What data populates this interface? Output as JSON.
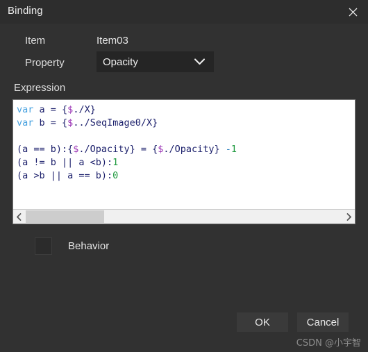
{
  "window": {
    "title": "Binding",
    "close_icon": "close-icon"
  },
  "form": {
    "item_label": "Item",
    "item_value": "Item03",
    "property_label": "Property",
    "property_selected": "Opacity",
    "property_chevron_icon": "chevron-down-icon",
    "expression_label": "Expression"
  },
  "expression": {
    "lines": [
      [
        {
          "t": "var",
          "c": "kw"
        },
        {
          "t": " a = {",
          "c": "def"
        },
        {
          "t": "$",
          "c": "var"
        },
        {
          "t": "./X}",
          "c": "def"
        }
      ],
      [
        {
          "t": "var",
          "c": "kw"
        },
        {
          "t": " b = {",
          "c": "def"
        },
        {
          "t": "$",
          "c": "var"
        },
        {
          "t": "../SeqImage0/X}",
          "c": "def"
        }
      ],
      [],
      [
        {
          "t": "(a == b):{",
          "c": "def"
        },
        {
          "t": "$",
          "c": "var"
        },
        {
          "t": "./Opacity} = {",
          "c": "def"
        },
        {
          "t": "$",
          "c": "var"
        },
        {
          "t": "./Opacity} ",
          "c": "def"
        },
        {
          "t": "-",
          "c": "op"
        },
        {
          "t": "1",
          "c": "num"
        }
      ],
      [
        {
          "t": "(a != b || a <b):",
          "c": "def"
        },
        {
          "t": "1",
          "c": "num"
        }
      ],
      [
        {
          "t": "(a >b || a == b):",
          "c": "def"
        },
        {
          "t": "0",
          "c": "num"
        }
      ]
    ],
    "plain_text": "var a = {$./X}\nvar b = {$../SeqImage0/X}\n\n(a == b):{$./Opacity} = {$./Opacity} -1\n(a != b || a <b):1\n(a >b || a == b):0",
    "scrollbar": {
      "left_arrow_icon": "chevron-left-icon",
      "right_arrow_icon": "chevron-right-icon"
    }
  },
  "behavior": {
    "label": "Behavior",
    "checked": false
  },
  "footer": {
    "ok_label": "OK",
    "cancel_label": "Cancel"
  },
  "watermark": {
    "text": "CSDN @小宇智"
  },
  "colors": {
    "dialog_background": "#313131",
    "titlebar_background": "#2d2d2d",
    "input_background": "#252525",
    "editor_background": "#ffffff",
    "button_background": "#3a3a3a",
    "keyword": "#4aa3e0",
    "variable_sigil": "#9b34b5",
    "number": "#1f9a3f",
    "default_code": "#1b1f6b"
  }
}
